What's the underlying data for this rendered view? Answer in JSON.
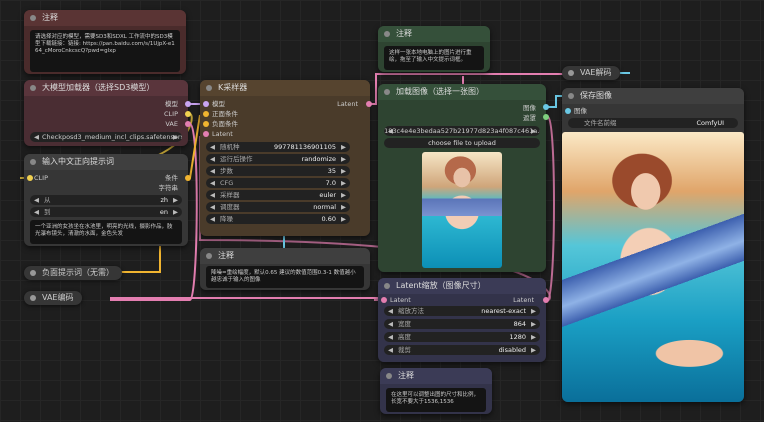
{
  "notes": {
    "top_left": {
      "title": "注释",
      "text": "请选择对应的模型，需要SD3和SDXL 工作流中的SD3模型下载链接：链接: https://pan.baidu.com/s/1UjpX-e164_cMoroCnkcscQ?pwd=glxp"
    },
    "top_right": {
      "title": "注释",
      "text": "这样一张本地电脑上的图片进行重绘，拖至了输入中文提示词框。"
    },
    "middle": {
      "title": "注释",
      "text": "降噪=重绘幅度，默认0.65 建议的数值范围0.3-1 数值越小越忠诚于输入的图像"
    },
    "bottom": {
      "title": "注释",
      "text": "在这里可以调整出图的尺寸和比例，长宽不要大于1536,1536"
    }
  },
  "checkpoint": {
    "title": "大模型加载器（选择SD3模型）",
    "outputs": [
      "模型",
      "CLIP",
      "VAE"
    ],
    "widget_label": "Checkpo",
    "widget_value": "sd3_medium_incl_clips.safetensors"
  },
  "ksampler": {
    "title": "K采样器",
    "inputs": [
      "模型",
      "正面条件",
      "负面条件",
      "Latent"
    ],
    "output": "Latent",
    "widgets": [
      {
        "label": "随机种",
        "value": "997781136901105"
      },
      {
        "label": "运行后操作",
        "value": "randomize"
      },
      {
        "label": "步数",
        "value": "35"
      },
      {
        "label": "CFG",
        "value": "7.0"
      },
      {
        "label": "采样器",
        "value": "euler"
      },
      {
        "label": "调度器",
        "value": "normal"
      },
      {
        "label": "降噪",
        "value": "0.60"
      }
    ]
  },
  "prompt_node": {
    "title": "输入中文正向提示词",
    "input": "CLIP",
    "output": "条件",
    "output2": "字符串",
    "widgets": [
      {
        "label": "从",
        "value": "zh"
      },
      {
        "label": "到",
        "value": "en"
      }
    ],
    "text": "一个亚洲的女孩坐在水池里，明亮的光线，摄影作品，肢光瀑布镜头，清澈的水面，金色头发"
  },
  "neg_prompt": {
    "title": "负面提示词（无需）"
  },
  "vae_encode": {
    "title": "VAE编码"
  },
  "vae_decode": {
    "title": "VAE解码"
  },
  "load_image": {
    "title": "加载图像（选择一张图）",
    "outputs": [
      "图像",
      "遮罩"
    ],
    "filename": "a6183c4e4e3bedaa527b21977d823a4f087c461a.png",
    "upload_label": "choose file to upload"
  },
  "latent_scale": {
    "title": "Latent缩放（图像尺寸）",
    "input": "Latent",
    "output": "Latent",
    "widgets": [
      {
        "label": "缩放方法",
        "value": "nearest-exact"
      },
      {
        "label": "宽度",
        "value": "864"
      },
      {
        "label": "高度",
        "value": "1280"
      },
      {
        "label": "裁剪",
        "value": "disabled"
      }
    ]
  },
  "save_image": {
    "title": "保存图像",
    "input": "图像",
    "widget_label": "文件名前缀",
    "widget_value": "ComfyUI"
  },
  "colors": {
    "bg": "#1e1e1e",
    "note_red": "#4a2b2b",
    "checkpoint": "#4a2d33",
    "ksampler": "#4a3b2a",
    "prompt": "#363636",
    "green": "#2e4431",
    "latent": "#33334a",
    "link_pink": "#e37eb0",
    "link_yellow": "#f0b430",
    "link_purple": "#c9a4f1",
    "link_blue": "#6ac8e4"
  }
}
